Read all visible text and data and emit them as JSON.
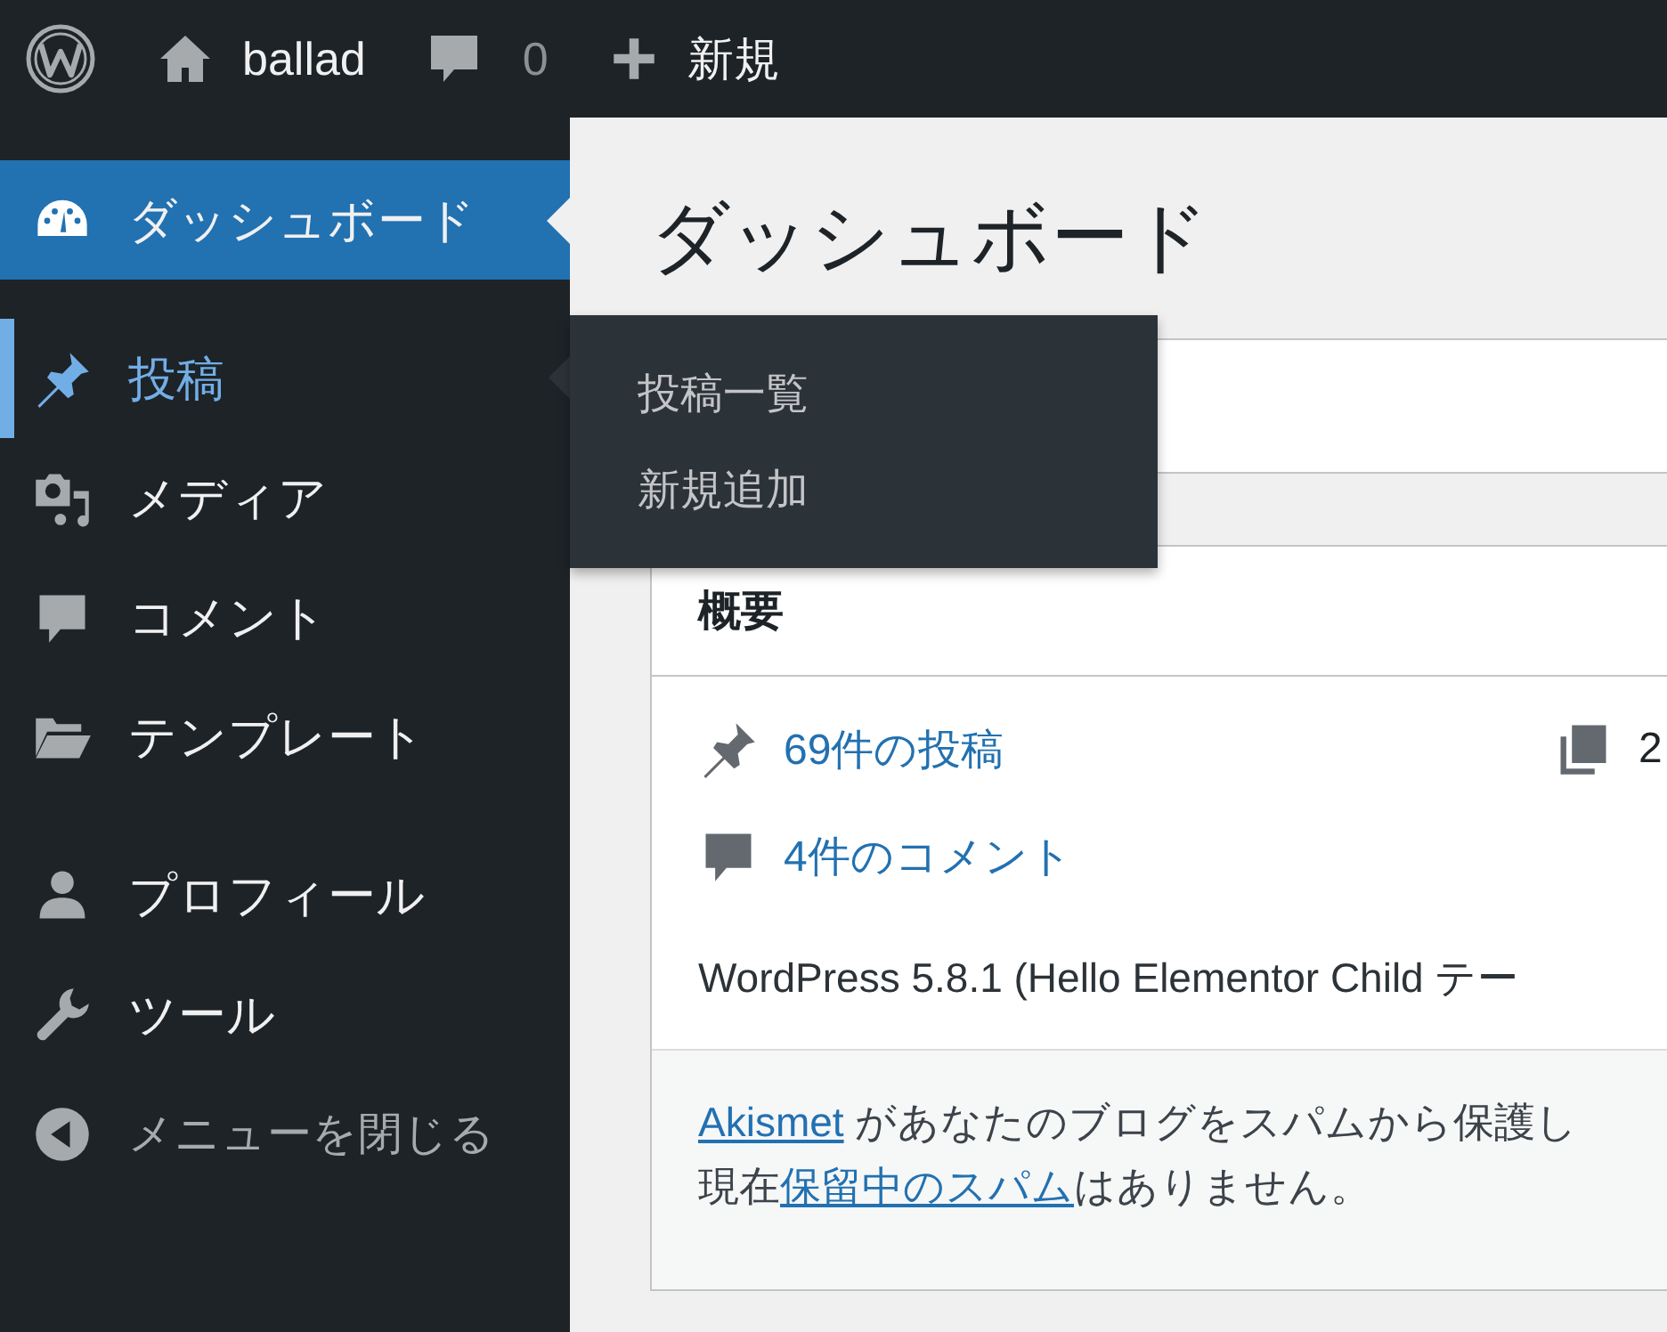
{
  "admin_bar": {
    "site_name": "ballad",
    "comment_count": "0",
    "new_label": "新規"
  },
  "sidebar": {
    "groups": [
      [
        {
          "kind": "dashboard",
          "label": "ダッシュボード",
          "selected": true,
          "expanded": false
        }
      ],
      [
        {
          "kind": "posts",
          "label": "投稿",
          "selected": false,
          "expanded": true,
          "submenu": [
            {
              "label": "投稿一覧"
            },
            {
              "label": "新規追加"
            }
          ]
        },
        {
          "kind": "media",
          "label": "メディア",
          "selected": false,
          "expanded": false
        },
        {
          "kind": "comments",
          "label": "コメント",
          "selected": false,
          "expanded": false
        },
        {
          "kind": "templates",
          "label": "テンプレート",
          "selected": false,
          "expanded": false
        }
      ],
      [
        {
          "kind": "profile",
          "label": "プロフィール",
          "selected": false,
          "expanded": false
        },
        {
          "kind": "tools",
          "label": "ツール",
          "selected": false,
          "expanded": false
        },
        {
          "kind": "collapse",
          "label": "メニューを閉じる",
          "selected": false,
          "expanded": false
        }
      ]
    ]
  },
  "page_title": "ダッシュボード",
  "overview": {
    "title": "概要",
    "glance": [
      {
        "kind": "posts",
        "label": "69件の投稿"
      },
      {
        "kind": "pages",
        "label": "2"
      },
      {
        "kind": "comments",
        "label": "4件のコメント"
      }
    ],
    "version": "WordPress 5.8.1 (Hello Elementor Child テー",
    "footer_lines": [
      [
        {
          "kind": "link",
          "text": "Akismet"
        },
        {
          "kind": "text",
          "text": " があなたのブログをスパムから保護し"
        }
      ],
      [
        {
          "kind": "text",
          "text": "現在"
        },
        {
          "kind": "link",
          "text": "保留中のスパム"
        },
        {
          "kind": "text",
          "text": "はありません。"
        }
      ]
    ]
  }
}
